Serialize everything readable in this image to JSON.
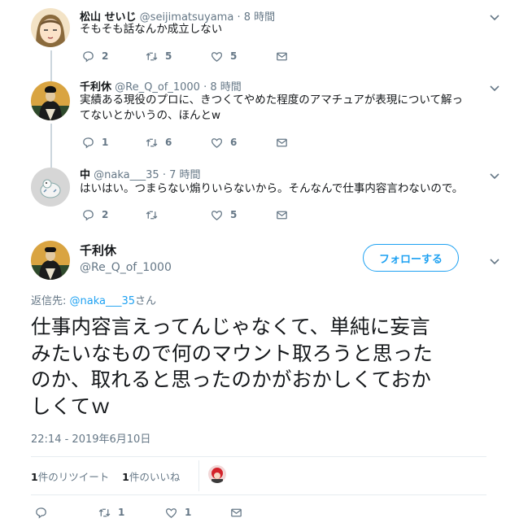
{
  "tweets": [
    {
      "name": "松山 せいじ",
      "handle": "@seijimatsuyama",
      "dot": "·",
      "time": "8 時間",
      "text": "そもそも話なんか成立しない",
      "replies": "2",
      "retweets": "5",
      "likes": "5"
    },
    {
      "name": "千利休",
      "handle": "@Re_Q_of_1000",
      "dot": "·",
      "time": "8 時間",
      "text_line1": "実績ある現役のプロに、きつくてやめた程度のアマチュアが表現について解っ",
      "text_line2": "てないとかいうの、ほんとw",
      "replies": "1",
      "retweets": "6",
      "likes": "6"
    },
    {
      "name": "中",
      "handle": "@naka___35",
      "dot": "·",
      "time": "7 時間",
      "text": "はいはい。つまらない煽りいらないから。そんなんで仕事内容言わないので。",
      "replies": "2",
      "retweets": "",
      "likes": "5"
    }
  ],
  "main": {
    "name": "千利休",
    "handle": "@Re_Q_of_1000",
    "follow_label": "フォローする",
    "reply_prefix": "返信先: ",
    "reply_handle": "@naka___35",
    "reply_suffix": "さん",
    "text_line1": "仕事内容言えってんじゃなくて、単純に妄言",
    "text_line2": "みたいなもので何のマウント取ろうと思った",
    "text_line3": "のか、取れると思ったのかがおかしくておか",
    "text_line4": "しくてｗ",
    "timestamp": "22:14 - 2019年6月10日",
    "retweet_count": "1",
    "retweet_label": "件のリツイート",
    "like_count": "1",
    "like_label": "件のいいね",
    "replies": "",
    "retweets": "1",
    "likes": "1"
  },
  "colors": {
    "accent": "#1da1f2",
    "muted": "#657786",
    "text": "#14171a",
    "divider": "#e6ecf0"
  },
  "icons": [
    "reply-icon",
    "retweet-icon",
    "like-icon",
    "message-icon",
    "chevron-down-icon"
  ]
}
